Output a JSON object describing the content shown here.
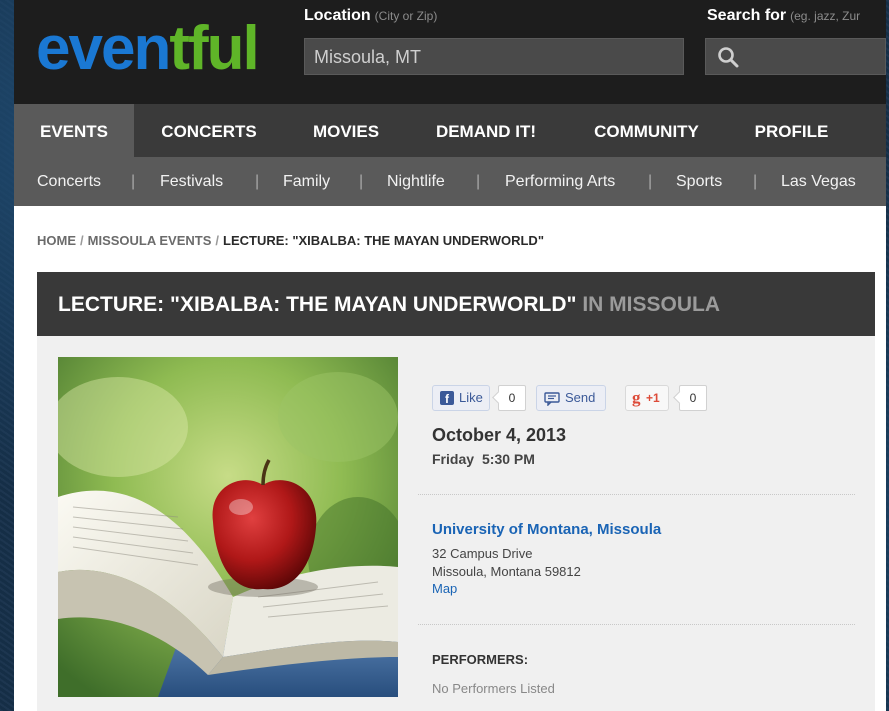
{
  "header": {
    "logo": {
      "part1": "even",
      "part2": "tful"
    },
    "location_label": "Location",
    "location_hint": "(City or Zip)",
    "location_value": "Missoula, MT",
    "search_label": "Search for",
    "search_hint": "(eg. jazz, Zur"
  },
  "main_nav": [
    "EVENTS",
    "CONCERTS",
    "MOVIES",
    "DEMAND IT!",
    "COMMUNITY",
    "PROFILE"
  ],
  "sub_nav": [
    "Concerts",
    "Festivals",
    "Family",
    "Nightlife",
    "Performing Arts",
    "Sports",
    "Las Vegas"
  ],
  "breadcrumb": {
    "home": "HOME",
    "city": "MISSOULA EVENTS",
    "current": "LECTURE: \"XIBALBA: THE MAYAN UNDERWORLD\"",
    "separator": "/"
  },
  "title": {
    "main": "LECTURE: \"XIBALBA: THE MAYAN UNDERWORLD\"",
    "suffix": "IN MISSOULA"
  },
  "social": {
    "like_label": "Like",
    "like_count": "0",
    "send_label": "Send",
    "gplus_label": "+1",
    "gplus_count": "0"
  },
  "event": {
    "date": "October 4, 2013",
    "day": "Friday",
    "time": "5:30 PM",
    "venue": "University of Montana, Missoula",
    "address_line1": "32 Campus Drive",
    "address_line2": "Missoula, Montana 59812",
    "map_link": "Map",
    "performers_heading": "PERFORMERS:",
    "performers_value": "No Performers Listed"
  },
  "colors": {
    "logo_blue": "#1a78d3",
    "logo_green": "#5fb528",
    "link_blue": "#1a64b5",
    "header_bg": "#1d1d1d"
  },
  "image": {
    "subject": "red apple on open book"
  }
}
